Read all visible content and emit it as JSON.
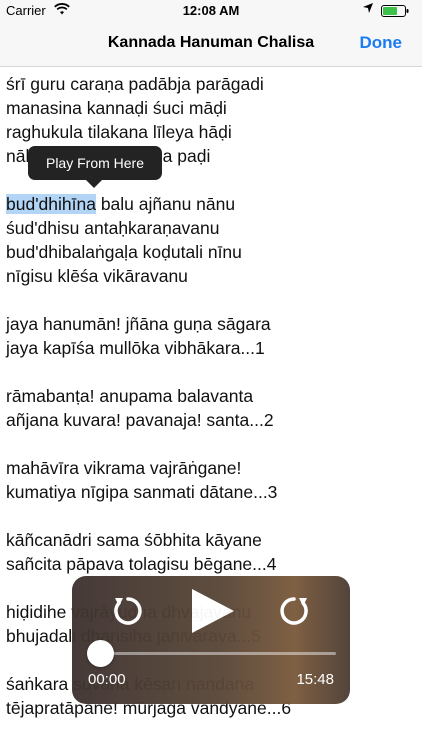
{
  "status_bar": {
    "carrier": "Carrier",
    "time": "12:08 AM"
  },
  "nav": {
    "title": "Kannada Hanuman Chalisa",
    "done_label": "Done"
  },
  "lyrics": {
    "stanza1": [
      "śrī guru caraṇa padābja parāgadi",
      "manasina kannaḍi śuci māḍi",
      "raghukula tilakana līleya hāḍi",
      "nālku phalagaḷa bēga paḍi"
    ],
    "stanza2_first_highlight": "bud'dhihīna",
    "stanza2_first_rest": " balu ajñanu nānu",
    "stanza2": [
      "śud'dhisu antaḥkaraṇavanu",
      "bud'dhibalaṅgaḷa koḍutali nīnu",
      "nīgisu klēśa vikāravanu"
    ],
    "stanza3": [
      "jaya hanumān! jñāna guṇa sāgara",
      "jaya kapīśa mullōka vibhākara...1"
    ],
    "stanza4": [
      "rāmabanṭa! anupama balavanta",
      "añjana kuvara! pavanaja! santa...2"
    ],
    "stanza5": [
      "mahāvīra vikrama vajrāṅgane!",
      "kumatiya nīgipa sanmati dātane...3"
    ],
    "stanza6": [
      "kāñcanādri sama śōbhita kāyane",
      "sañcita pāpava tolagisu bēgane...4"
    ],
    "stanza7": [
      "hiḍidihe vajrāyudha dhvajavanu",
      "bhujadali dharisiha janivārava...5"
    ],
    "stanza8": [
      "śaṅkara suvana kēsari nandana",
      "tējapratāpane! mūrjaga vandyane...6"
    ]
  },
  "tooltip": {
    "label": "Play From Here"
  },
  "player": {
    "time_elapsed": "00:00",
    "time_total": "15:48",
    "progress": 0.0,
    "icons": {
      "rewind": "rewind-icon",
      "play": "play-icon",
      "forward": "forward-icon"
    }
  }
}
